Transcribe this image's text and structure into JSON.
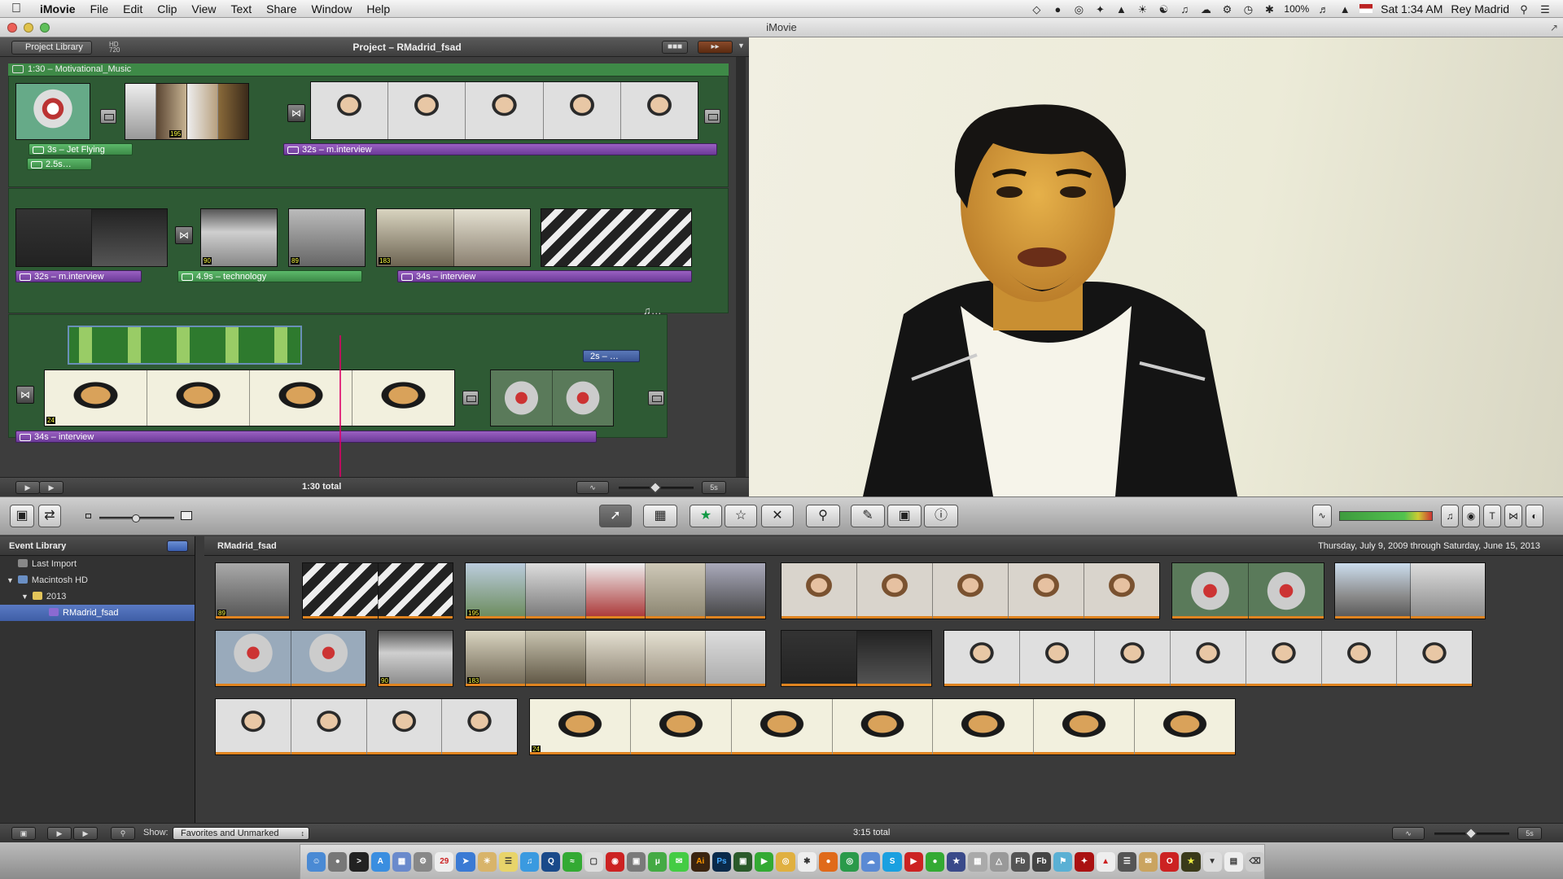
{
  "menubar": {
    "app_name": "iMovie",
    "menus": [
      "File",
      "Edit",
      "Clip",
      "View",
      "Text",
      "Share",
      "Window",
      "Help"
    ],
    "battery": "100%",
    "clock": "Sat 1:34 AM",
    "user": "Rey Madrid"
  },
  "window": {
    "title": "iMovie"
  },
  "project": {
    "library_button": "Project Library",
    "hd_badge": "HD 720",
    "title": "Project – RMadrid_fsad",
    "music_label": "1:30 – Motivational_Music",
    "row1": {
      "title1": "3s – Jet Flying",
      "title2": "2.5s…",
      "interview": "32s – m.interview",
      "clip2_duration": "195"
    },
    "row2": {
      "interview": "32s – m.interview",
      "technology": "4.9s – technology",
      "interview2": "34s – interview",
      "d1": "90",
      "d2": "89",
      "d3": "183"
    },
    "row3": {
      "overlay_label": "2s – …",
      "interview": "34s – interview",
      "music_note": "♫…",
      "d1": "24"
    },
    "total": "1:30 total",
    "zoom_label": "5s"
  },
  "toolbar": {
    "buttons": [
      "camera",
      "swap",
      "select",
      "crop-add",
      "favorite",
      "unfavorite",
      "reject",
      "keyword",
      "eyedropper",
      "crop",
      "info"
    ]
  },
  "event_library": {
    "header": "Event Library",
    "items": [
      {
        "label": "Last Import",
        "icon": "film-icon"
      },
      {
        "label": "Macintosh HD",
        "icon": "disk-icon"
      },
      {
        "label": "2013",
        "icon": "folder-icon"
      },
      {
        "label": "RMadrid_fsad",
        "icon": "star-icon"
      }
    ]
  },
  "events": {
    "name": "RMadrid_fsad",
    "date_range": "Thursday, July 9, 2009 through Saturday, June 15, 2013",
    "durations": {
      "a": "89",
      "b": "195",
      "c": "90",
      "d": "183",
      "e": "24"
    }
  },
  "bottom": {
    "show_label": "Show:",
    "show_value": "Favorites and Unmarked",
    "total": "3:15 total",
    "zoom_label": "5s"
  },
  "colors": {
    "storyboard_green": "#2e5a34",
    "title_purple": "#6b3a97",
    "selection_blue": "#3f5ea6",
    "playhead": "#dd0066"
  }
}
